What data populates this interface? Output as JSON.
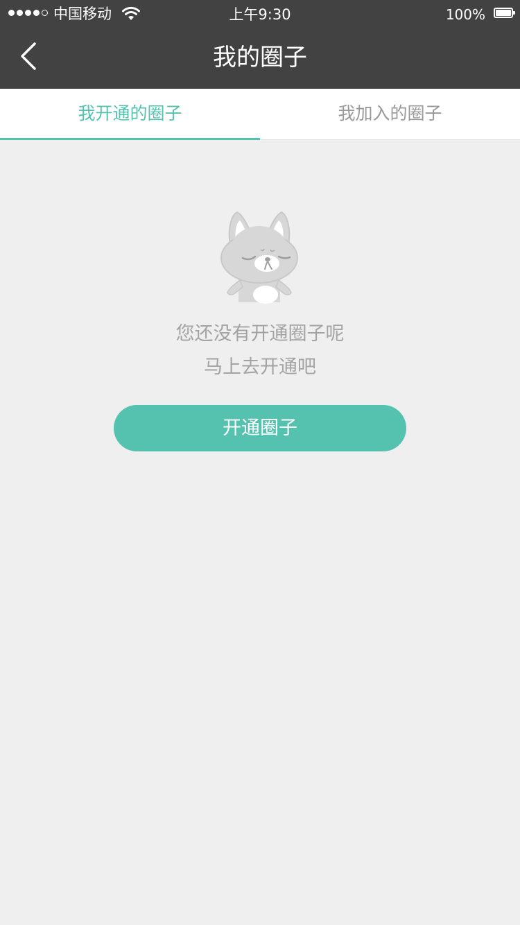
{
  "status_bar": {
    "carrier": "中国移动",
    "time": "上午9:30",
    "battery_percent": "100%",
    "battery_level": 1.0,
    "signal_bars_filled": 4,
    "signal_bars_total": 5,
    "icons": [
      "signal-icon",
      "wifi-icon",
      "battery-icon"
    ]
  },
  "nav": {
    "title": "我的圈子",
    "back_icon": "chevron-left-icon"
  },
  "tabs": [
    {
      "label": "我开通的圈子",
      "active": true
    },
    {
      "label": "我加入的圈子",
      "active": false
    }
  ],
  "empty_state": {
    "illustration": "sleeping-dog-icon",
    "line1": "您还没有开通圈子呢",
    "line2": "马上去开通吧",
    "button_label": "开通圈子"
  },
  "colors": {
    "accent": "#55c2b0",
    "header_bg": "#424242",
    "page_bg": "#efefef",
    "muted_text": "#a3a3a3"
  }
}
